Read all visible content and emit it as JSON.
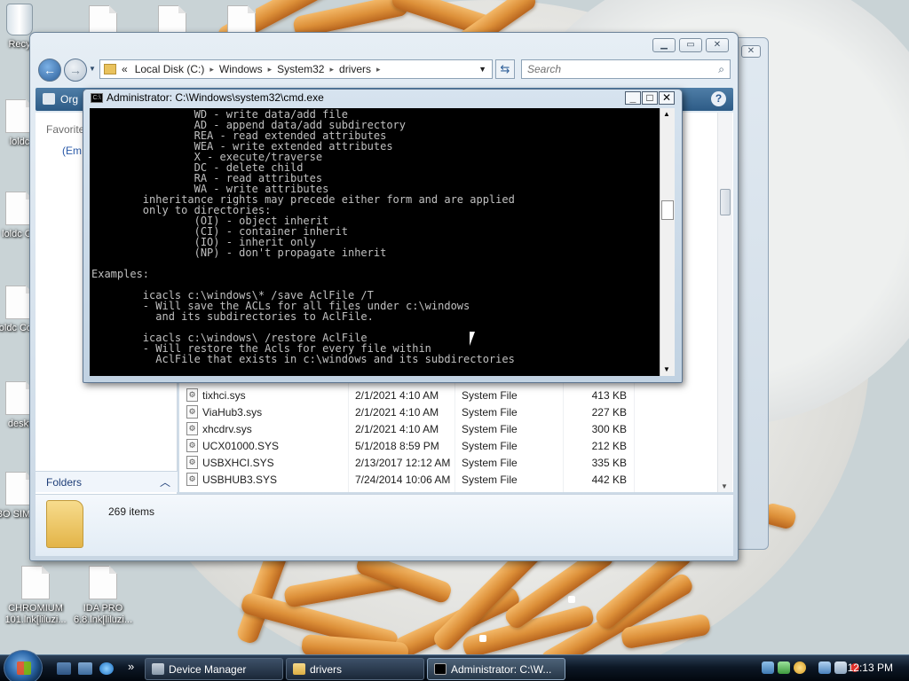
{
  "desktop": {
    "icons": [
      {
        "label": "Recy"
      },
      {
        "label": "loldc"
      },
      {
        "label": "loldc Co"
      },
      {
        "label": "loldc Copy"
      },
      {
        "label": "deskt"
      },
      {
        "label": "BO SIMUL"
      },
      {
        "label": "CHROMIUM 101.lnk[liluzi..."
      },
      {
        "label": "IDA PRO 6.8.lnk[liluzi..."
      }
    ]
  },
  "explorer": {
    "address": {
      "prefix": "«",
      "segments": [
        "Local Disk (C:)",
        "System32",
        "Windows",
        "drivers"
      ]
    },
    "search_placeholder": "Search",
    "toolbar": {
      "organize": "Org",
      "help": "?"
    },
    "nav": {
      "favorites": "Favorite",
      "empty": "(Em"
    },
    "folders_label": "Folders",
    "files": [
      {
        "name": "tixhci.sys",
        "date": "2/1/2021 4:10 AM",
        "type": "System File",
        "size": "413 KB"
      },
      {
        "name": "ViaHub3.sys",
        "date": "2/1/2021 4:10 AM",
        "type": "System File",
        "size": "227 KB"
      },
      {
        "name": "xhcdrv.sys",
        "date": "2/1/2021 4:10 AM",
        "type": "System File",
        "size": "300 KB"
      },
      {
        "name": "UCX01000.SYS",
        "date": "5/1/2018 8:59 PM",
        "type": "System File",
        "size": "212 KB"
      },
      {
        "name": "USBXHCI.SYS",
        "date": "2/13/2017 12:12 AM",
        "type": "System File",
        "size": "335 KB"
      },
      {
        "name": "USBHUB3.SYS",
        "date": "7/24/2014 10:06 AM",
        "type": "System File",
        "size": "442 KB"
      }
    ],
    "item_count": "269 items"
  },
  "cmd": {
    "title": "Administrator: C:\\Windows\\system32\\cmd.exe",
    "lines": [
      "                WD - write data/add file",
      "                AD - append data/add subdirectory",
      "                REA - read extended attributes",
      "                WEA - write extended attributes",
      "                X - execute/traverse",
      "                DC - delete child",
      "                RA - read attributes",
      "                WA - write attributes",
      "        inheritance rights may precede either form and are applied",
      "        only to directories:",
      "                (OI) - object inherit",
      "                (CI) - container inherit",
      "                (IO) - inherit only",
      "                (NP) - don't propagate inherit",
      "",
      "Examples:",
      "",
      "        icacls c:\\windows\\* /save AclFile /T",
      "        - Will save the ACLs for all files under c:\\windows",
      "          and its subdirectories to AclFile.",
      "",
      "        icacls c:\\windows\\ /restore AclFile",
      "        - Will restore the Acls for every file within",
      "          AclFile that exists in c:\\windows and its subdirectories"
    ]
  },
  "taskbar": {
    "tasks": [
      {
        "label": "Device Manager"
      },
      {
        "label": "drivers"
      },
      {
        "label": "Administrator: C:\\W..."
      }
    ],
    "clock": "12:13 PM",
    "quicklaunch_more": "»"
  }
}
